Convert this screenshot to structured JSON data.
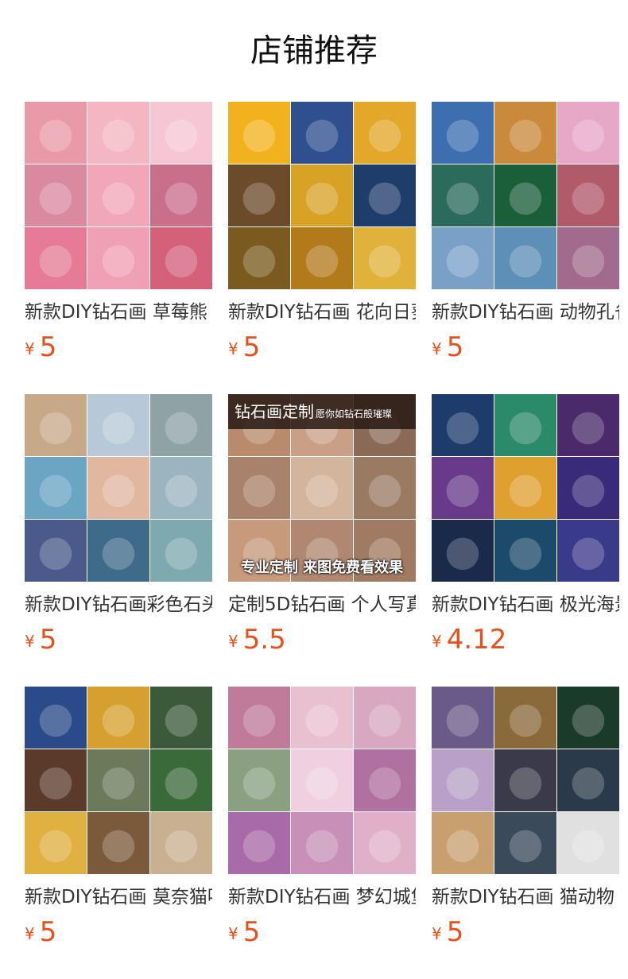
{
  "section_title": "店铺推荐",
  "currency_symbol": "¥",
  "colors": {
    "price": "#e8501a",
    "text": "#333333",
    "title": "#111111"
  },
  "products": [
    {
      "name": "新款DIY钻石画 草莓熊",
      "price": "5",
      "cells": [
        "#e99aa8",
        "#f4b6c2",
        "#f7c6d4",
        "#d98aa0",
        "#f1a7b8",
        "#c96f8c",
        "#e57b94",
        "#f0a0b4",
        "#d4607a"
      ]
    },
    {
      "name": "新款DIY钻石画 花向日葵",
      "price": "5",
      "cells": [
        "#f2b21d",
        "#2f4f8f",
        "#e3a82a",
        "#6b4b2a",
        "#d8a227",
        "#1f3d6b",
        "#7a5a1e",
        "#b37a1c",
        "#e0b23a"
      ]
    },
    {
      "name": "新款DIY钻石画 动物孔雀",
      "price": "5",
      "cells": [
        "#3d6fb0",
        "#c98a3c",
        "#e7a7c6",
        "#2a6b5c",
        "#1b5e3a",
        "#b05a6a",
        "#7aa0c8",
        "#5e8fb6",
        "#a26b8e"
      ]
    },
    {
      "name": "新款DIY钻石画彩色石头",
      "price": "5",
      "cells": [
        "#c7a98a",
        "#b7c9d8",
        "#8fa3a6",
        "#6aa5c4",
        "#e2b7a0",
        "#9ab5c0",
        "#4a5a8a",
        "#3e6b8a",
        "#7fa9b0"
      ]
    },
    {
      "name": "定制5D钻石画 个人写真",
      "price": "5.5",
      "overlay_top": "钻石画定制",
      "overlay_top_sub": "愿你如钻石般璀璨",
      "overlay_bottom": "专业定制 来图免费看效果",
      "cells": [
        "#b98a6c",
        "#c9a087",
        "#8a6a57",
        "#a8826a",
        "#d3b49c",
        "#9b7a64",
        "#c69a7a",
        "#b08770",
        "#a07a62"
      ]
    },
    {
      "name": "新款DIY钻石画 极光海景",
      "price": "4.12",
      "cells": [
        "#1d3b6b",
        "#2a8a6a",
        "#4a2a6b",
        "#6a3a8a",
        "#e0a030",
        "#3a2a7a",
        "#1a2a4a",
        "#1c4a6a",
        "#3a3a8a"
      ]
    },
    {
      "name": "新款DIY钻石画 莫奈猫咪",
      "price": "5",
      "cells": [
        "#2a4a8a",
        "#d6a030",
        "#3a5a3a",
        "#5a3a2a",
        "#6a7a5a",
        "#3a6a3a",
        "#e0b040",
        "#7a5a3a",
        "#c8b090"
      ]
    },
    {
      "name": "新款DIY钻石画 梦幻城堡",
      "price": "5",
      "cells": [
        "#c07a9a",
        "#e8c0d0",
        "#d8a8c0",
        "#8aa080",
        "#f0d0e0",
        "#b070a0",
        "#a86aa8",
        "#c890b8",
        "#e0b0c8"
      ]
    },
    {
      "name": "新款DIY钻石画 猫动物",
      "price": "5",
      "cells": [
        "#6a5a8a",
        "#8a6a3a",
        "#1a3a2a",
        "#b8a0c8",
        "#3a3a4a",
        "#2a3a4a",
        "#c8a070",
        "#3a4a5a",
        "#e0e0e0"
      ]
    }
  ]
}
